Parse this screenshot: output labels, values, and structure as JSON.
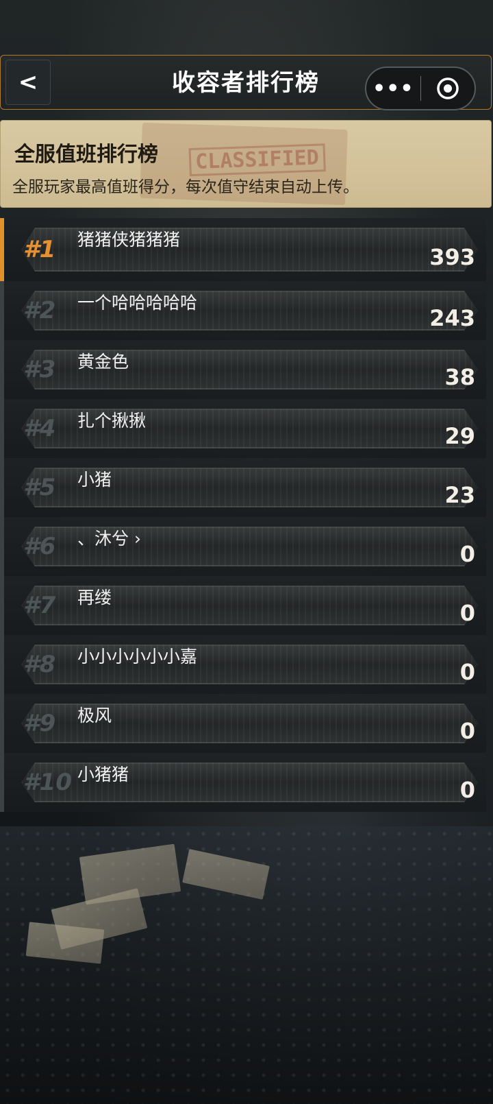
{
  "header": {
    "back_label": "<",
    "title": "收容者排行榜",
    "more_label": "•••"
  },
  "banner": {
    "title": "全服值班排行榜",
    "description": "全服玩家最高值班得分，每次值守结束自动上传。",
    "stamp_text": "CLASSIFIED"
  },
  "leaderboard": [
    {
      "rank": "#1",
      "name": "猪猪侠猪猪猪",
      "score": "393"
    },
    {
      "rank": "#2",
      "name": "一个哈哈哈哈哈",
      "score": "243"
    },
    {
      "rank": "#3",
      "name": "黄金色",
      "score": "38"
    },
    {
      "rank": "#4",
      "name": "扎个揪揪",
      "score": "29"
    },
    {
      "rank": "#5",
      "name": "小猪",
      "score": "23"
    },
    {
      "rank": "#6",
      "name": "、沐兮 ›",
      "score": "0"
    },
    {
      "rank": "#7",
      "name": "再缕",
      "score": "0"
    },
    {
      "rank": "#8",
      "name": "小小小小小小嘉",
      "score": "0"
    },
    {
      "rank": "#9",
      "name": "极风",
      "score": "0"
    },
    {
      "rank": "#10",
      "name": "小猪猪",
      "score": "0"
    }
  ],
  "colors": {
    "accent": "#e0912b",
    "banner_bg": "#d9c9a3",
    "border": "#b07a2a"
  }
}
